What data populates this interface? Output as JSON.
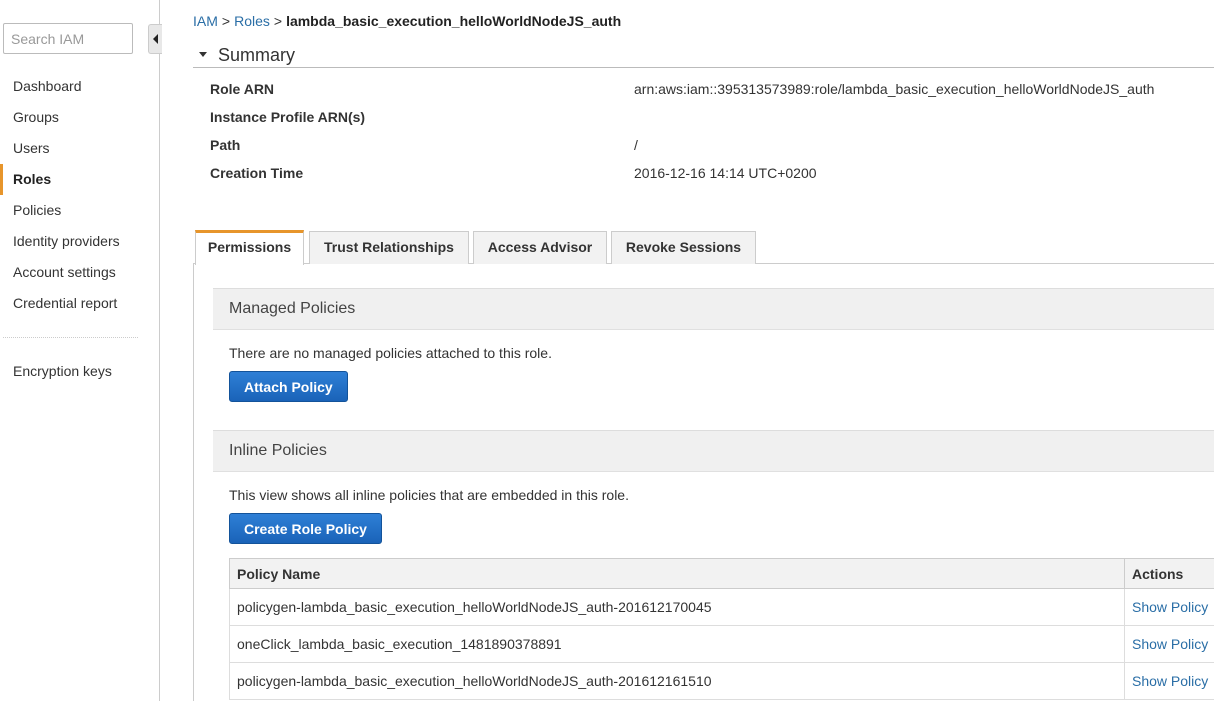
{
  "sidebar": {
    "search_placeholder": "Search IAM",
    "items": [
      {
        "label": "Dashboard"
      },
      {
        "label": "Groups"
      },
      {
        "label": "Users"
      },
      {
        "label": "Roles"
      },
      {
        "label": "Policies"
      },
      {
        "label": "Identity providers"
      },
      {
        "label": "Account settings"
      },
      {
        "label": "Credential report"
      }
    ],
    "active_item": "Roles",
    "bottom_item": "Encryption keys"
  },
  "breadcrumb": {
    "items": [
      "IAM",
      "Roles"
    ],
    "separator": ">",
    "current": "lambda_basic_execution_helloWorldNodeJS_auth"
  },
  "summary": {
    "title": "Summary",
    "rows": [
      {
        "label": "Role ARN",
        "value": "arn:aws:iam::395313573989:role/lambda_basic_execution_helloWorldNodeJS_auth"
      },
      {
        "label": "Instance Profile ARN(s)",
        "value": ""
      },
      {
        "label": "Path",
        "value": "/"
      },
      {
        "label": "Creation Time",
        "value": "2016-12-16 14:14 UTC+0200"
      }
    ]
  },
  "tabs": [
    {
      "label": "Permissions",
      "active": true
    },
    {
      "label": "Trust Relationships",
      "active": false
    },
    {
      "label": "Access Advisor",
      "active": false
    },
    {
      "label": "Revoke Sessions",
      "active": false
    }
  ],
  "managed_policies": {
    "title": "Managed Policies",
    "message": "There are no managed policies attached to this role.",
    "button_label": "Attach Policy"
  },
  "inline_policies": {
    "title": "Inline Policies",
    "message": "This view shows all inline policies that are embedded in this role.",
    "button_label": "Create Role Policy",
    "columns": [
      "Policy Name",
      "Actions"
    ],
    "rows": [
      {
        "name": "policygen-lambda_basic_execution_helloWorldNodeJS_auth-201612170045",
        "action": "Show Policy"
      },
      {
        "name": "oneClick_lambda_basic_execution_1481890378891",
        "action": "Show Policy"
      },
      {
        "name": "policygen-lambda_basic_execution_helloWorldNodeJS_auth-201612161510",
        "action": "Show Policy"
      }
    ]
  },
  "colors": {
    "accent": "#e7952b",
    "link": "#2a6ea6",
    "button": "#1a63b8"
  }
}
